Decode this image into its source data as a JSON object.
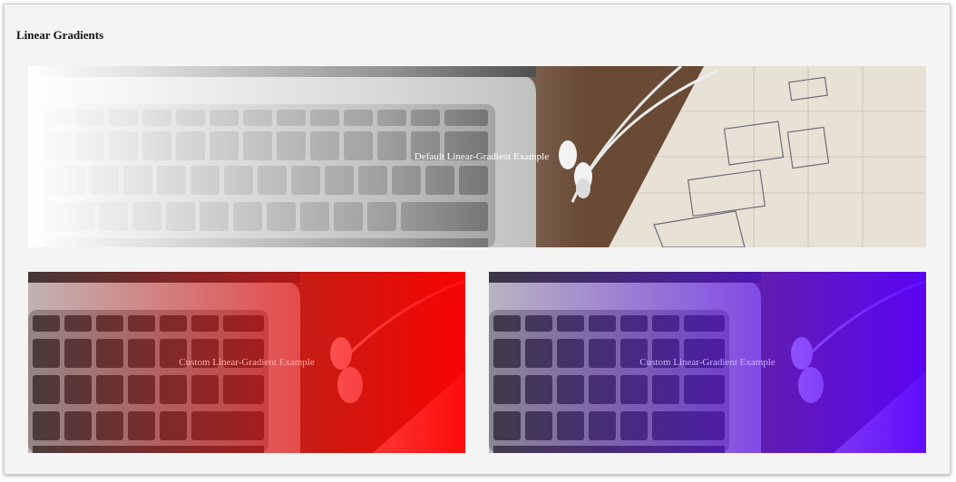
{
  "page": {
    "title": "Linear Gradients"
  },
  "banners": {
    "default": {
      "text": "Default Linear-Gradient Example"
    },
    "red": {
      "text": "Custom Linear-Gradient Example",
      "overlay_color": "#ff0000"
    },
    "purple": {
      "text": "Custom Linear-Gradient Example",
      "overlay_color": "#5a00ff"
    }
  },
  "colors": {
    "page_background": "#f4f4f4",
    "wood": "#6b4a33",
    "laptop": "#b9b9b9",
    "key": "#555555",
    "paper": "#ece6dc"
  }
}
